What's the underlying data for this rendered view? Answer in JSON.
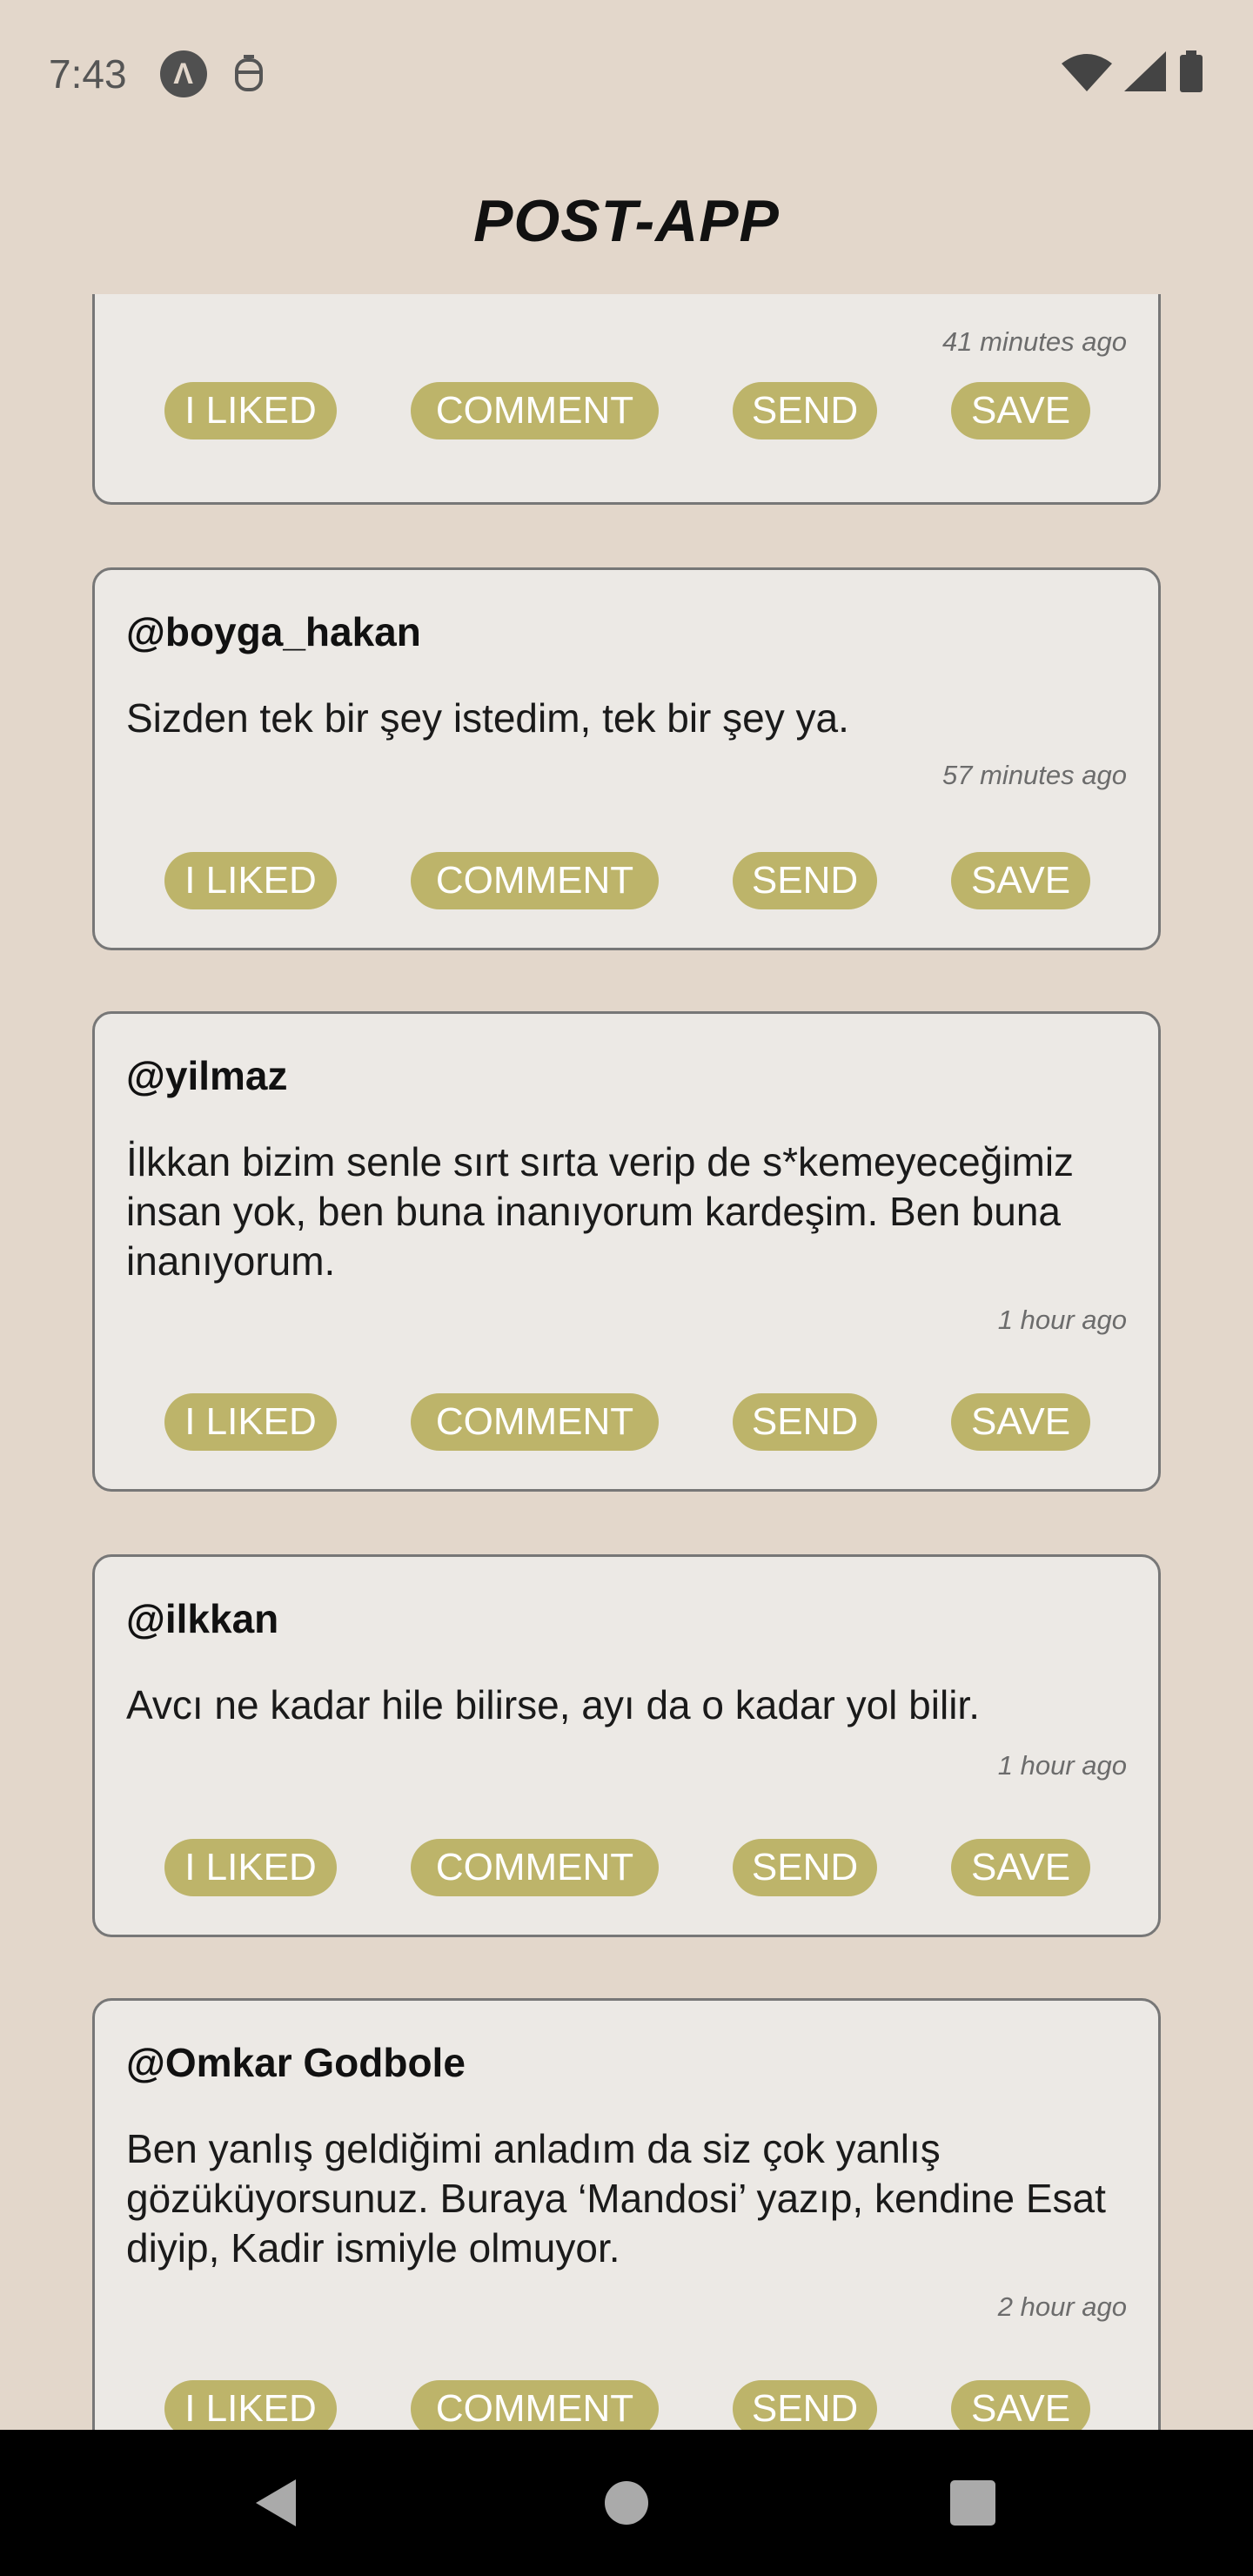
{
  "status_bar": {
    "time": "7:43",
    "left_icons": [
      "app-badge-icon",
      "face-icon"
    ],
    "right_icons": [
      "wifi-icon",
      "signal-icon",
      "battery-icon"
    ]
  },
  "header": {
    "title": "POST-APP"
  },
  "actions": {
    "like": "I LIKED",
    "comment": "COMMENT",
    "send": "SEND",
    "save": "SAVE"
  },
  "posts": [
    {
      "author": "",
      "text": "",
      "time": "41 minutes ago"
    },
    {
      "author": "@boyga_hakan",
      "text": "Sizden tek bir şey istedim, tek bir şey ya.",
      "time": "57 minutes ago"
    },
    {
      "author": "@yilmaz",
      "text": "İlkkan bizim senle sırt sırta verip de s*kemeyeceğimiz insan yok, ben buna inanıyorum kardeşim. Ben buna inanıyorum.",
      "time": "1 hour ago"
    },
    {
      "author": "@ilkkan",
      "text": "Avcı ne kadar hile bilirse, ayı da o kadar yol bilir.",
      "time": "1 hour ago"
    },
    {
      "author": "@Omkar Godbole",
      "text": "Ben yanlış geldiğimi anladım da siz çok yanlış gözüküyorsunuz. Buraya ‘Mandosi’ yazıp, kendine Esat diyip, Kadir ismiyle olmuyor.",
      "time": "2 hour ago"
    }
  ],
  "colors": {
    "background": "#e3d7cb",
    "card": "#ece9e5",
    "button": "#bdb46a",
    "nav": "#000000"
  },
  "nav_bar": {
    "buttons": [
      "back-icon",
      "home-icon",
      "recents-icon"
    ]
  }
}
